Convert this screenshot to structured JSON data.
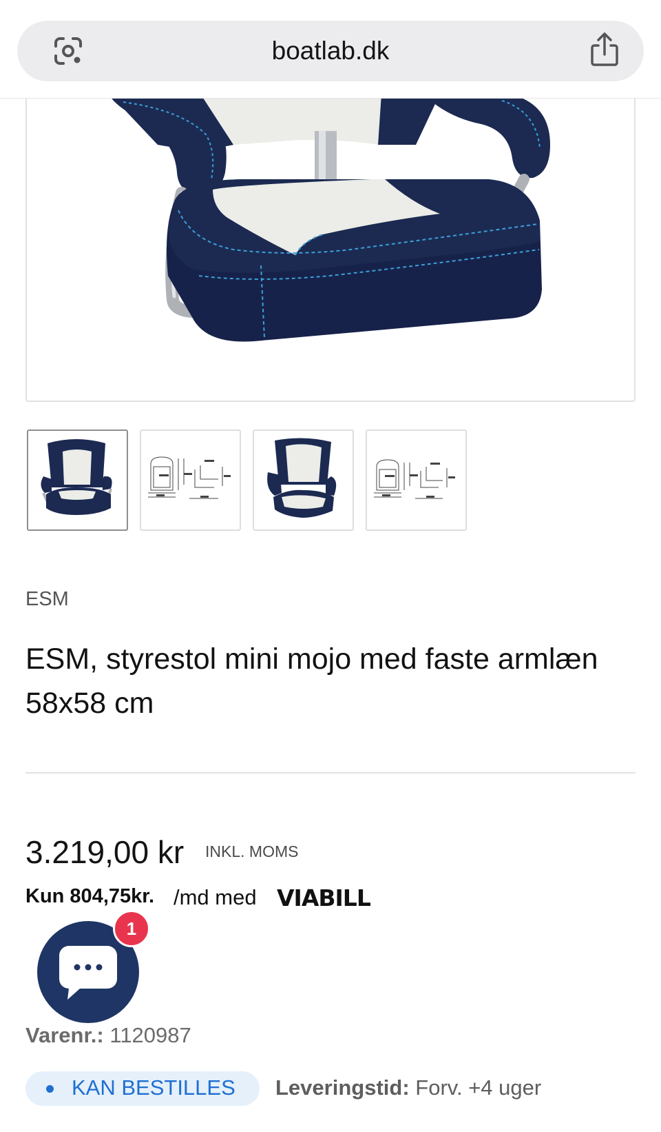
{
  "browser": {
    "url": "boatlab.dk"
  },
  "product": {
    "brand": "ESM",
    "title": "ESM, styrestol mini mojo med faste armlæn 58x58 cm",
    "price": "3.219,00 kr",
    "vat_label": "INKL. MOMS",
    "installment_prefix": "Kun 804,75kr.",
    "installment_suffix": "/md med",
    "financing_brand": "VIABILL",
    "sku_label": "Varenr.:",
    "sku_value": "1120987",
    "stock_status": "KAN BESTILLES",
    "delivery_label": "Leveringstid:",
    "delivery_value": "Forv. +4 uger"
  },
  "gallery": {
    "thumbnails": [
      "seat-photo",
      "dimension-drawing",
      "seat-photo-alt",
      "dimension-drawing-alt"
    ],
    "active_index": 0
  },
  "chat": {
    "unread_count": "1"
  },
  "colors": {
    "seat_navy": "#1c2a52",
    "seat_white": "#ecece8",
    "stitching": "#3aa0d8",
    "chat_bg": "#1f3565",
    "badge_red": "#e8354d",
    "stock_blue": "#1e6fd0",
    "stock_bg": "#e5f0fb"
  }
}
